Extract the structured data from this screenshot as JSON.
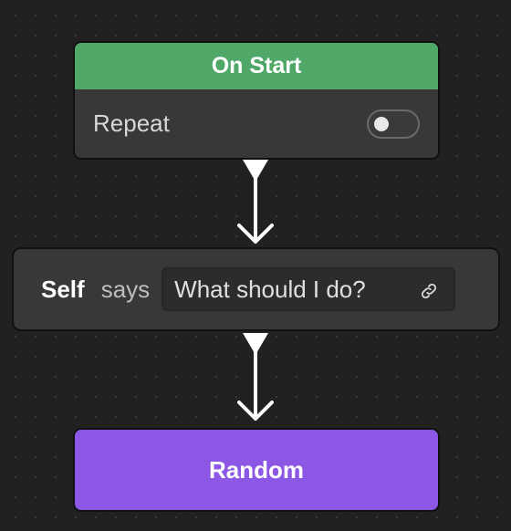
{
  "on_start": {
    "title": "On Start",
    "repeat_label": "Repeat",
    "repeat_enabled": false,
    "header_color": "#4fa868"
  },
  "say_block": {
    "subject": "Self",
    "verb": "says",
    "message": "What should I do?"
  },
  "random_block": {
    "label": "Random",
    "color": "#8b57e4"
  },
  "icons": {
    "connector": "arrow-down-icon",
    "link": "link-icon",
    "toggle": "toggle-icon"
  }
}
